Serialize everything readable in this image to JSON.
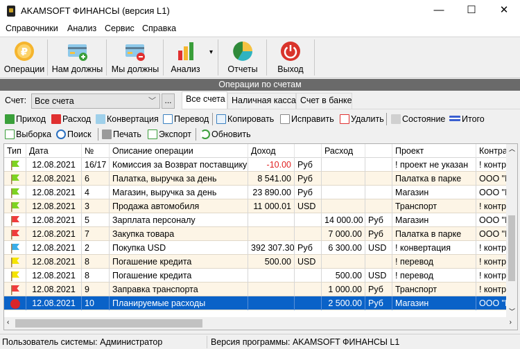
{
  "window": {
    "title": "AKAMSOFT ФИНАНСЫ (версия  L1)",
    "minimize": "—",
    "maximize": "☐",
    "close": "✕"
  },
  "menu": [
    "Справочники",
    "Анализ",
    "Сервис",
    "Справка"
  ],
  "toolbar": [
    {
      "label": "Операции",
      "icon": "ruble-coin-icon"
    },
    {
      "label": "Нам должны",
      "icon": "card-plus-icon"
    },
    {
      "label": "Мы должны",
      "icon": "card-minus-icon"
    },
    {
      "label": "Анализ",
      "icon": "bar-chart-icon",
      "dropdown": "▾"
    },
    {
      "label": "Отчеты",
      "icon": "pie-chart-icon"
    },
    {
      "label": "Выход",
      "icon": "power-icon"
    }
  ],
  "section_title": "Операции по счетам",
  "account": {
    "label": "Счет:",
    "value": "Все счета",
    "chevron": "﹀",
    "browse": "..."
  },
  "tabs": [
    "Все счета",
    "Наличная касса",
    "Счет в банке"
  ],
  "actions_row1": [
    "Приход",
    "Расход",
    "Конвертация",
    "Перевод",
    "Копировать",
    "Исправить",
    "Удалить",
    "Состояние",
    "Итого"
  ],
  "actions_row2": [
    "Выборка",
    "Поиск",
    "Печать",
    "Экспорт",
    "Обновить"
  ],
  "grid": {
    "columns": [
      "Тип",
      "Дата",
      "№",
      "Описание операции",
      "Доход",
      "",
      "Расход",
      "",
      "Проект",
      "Контра"
    ],
    "flag_colors": {
      "income": "#7ed321",
      "expense": "#f03c3c",
      "convert": "#3aaee8",
      "transfer": "#f5e400",
      "planned": "#d9262b"
    },
    "rows": [
      {
        "type": "income",
        "date": "12.08.2021",
        "num": "16/17",
        "desc": "Комиссия за Возврат поставщику (",
        "income": "-10.00",
        "income_cur": "Руб",
        "expense": "",
        "expense_cur": "",
        "project": "! проект не указан",
        "contra": "! контра"
      },
      {
        "type": "income",
        "date": "12.08.2021",
        "num": "6",
        "desc": "Палатка, выручка за день",
        "income": "8 541.00",
        "income_cur": "Руб",
        "expense": "",
        "expense_cur": "",
        "project": "Палатка в парке",
        "contra": "ООО \"М"
      },
      {
        "type": "income",
        "date": "12.08.2021",
        "num": "4",
        "desc": "Магазин, выручка за день",
        "income": "23 890.00",
        "income_cur": "Руб",
        "expense": "",
        "expense_cur": "",
        "project": "Магазин",
        "contra": "ООО \"М"
      },
      {
        "type": "income",
        "date": "12.08.2021",
        "num": "3",
        "desc": "Продажа автомобиля",
        "income": "11 000.01",
        "income_cur": "USD",
        "expense": "",
        "expense_cur": "",
        "project": "Транспорт",
        "contra": "! контра"
      },
      {
        "type": "expense",
        "date": "12.08.2021",
        "num": "5",
        "desc": "Зарплата персоналу",
        "income": "",
        "income_cur": "",
        "expense": "14 000.00",
        "expense_cur": "Руб",
        "project": "Магазин",
        "contra": "ООО \"М"
      },
      {
        "type": "expense",
        "date": "12.08.2021",
        "num": "7",
        "desc": "Закупка товара",
        "income": "",
        "income_cur": "",
        "expense": "7 000.00",
        "expense_cur": "Руб",
        "project": "Палатка в парке",
        "contra": "ООО \"М"
      },
      {
        "type": "convert",
        "date": "12.08.2021",
        "num": "2",
        "desc": "Покупка USD",
        "income": "392 307.30",
        "income_cur": "Руб",
        "expense": "6 300.00",
        "expense_cur": "USD",
        "project": "! конвертация",
        "contra": "! контра"
      },
      {
        "type": "transfer",
        "date": "12.08.2021",
        "num": "8",
        "desc": "Погашение кредита",
        "income": "500.00",
        "income_cur": "USD",
        "expense": "",
        "expense_cur": "",
        "project": "! перевод",
        "contra": "! контра"
      },
      {
        "type": "transfer",
        "date": "12.08.2021",
        "num": "8",
        "desc": "Погашение кредита",
        "income": "",
        "income_cur": "",
        "expense": "500.00",
        "expense_cur": "USD",
        "project": "! перевод",
        "contra": "! контра"
      },
      {
        "type": "expense",
        "date": "12.08.2021",
        "num": "9",
        "desc": "Заправка транспорта",
        "income": "",
        "income_cur": "",
        "expense": "1 000.00",
        "expense_cur": "Руб",
        "project": "Транспорт",
        "contra": "! контра"
      },
      {
        "type": "planned",
        "date": "12.08.2021",
        "num": "10",
        "desc": "Планируемые расходы",
        "income": "",
        "income_cur": "",
        "expense": "2 500.00",
        "expense_cur": "Руб",
        "project": "Магазин",
        "contra": "ООО \"М",
        "selected": true
      }
    ]
  },
  "status": {
    "user": "Пользователь системы: Администратор",
    "version": "Версия программы: AKAMSOFT ФИНАНСЫ  L1"
  }
}
